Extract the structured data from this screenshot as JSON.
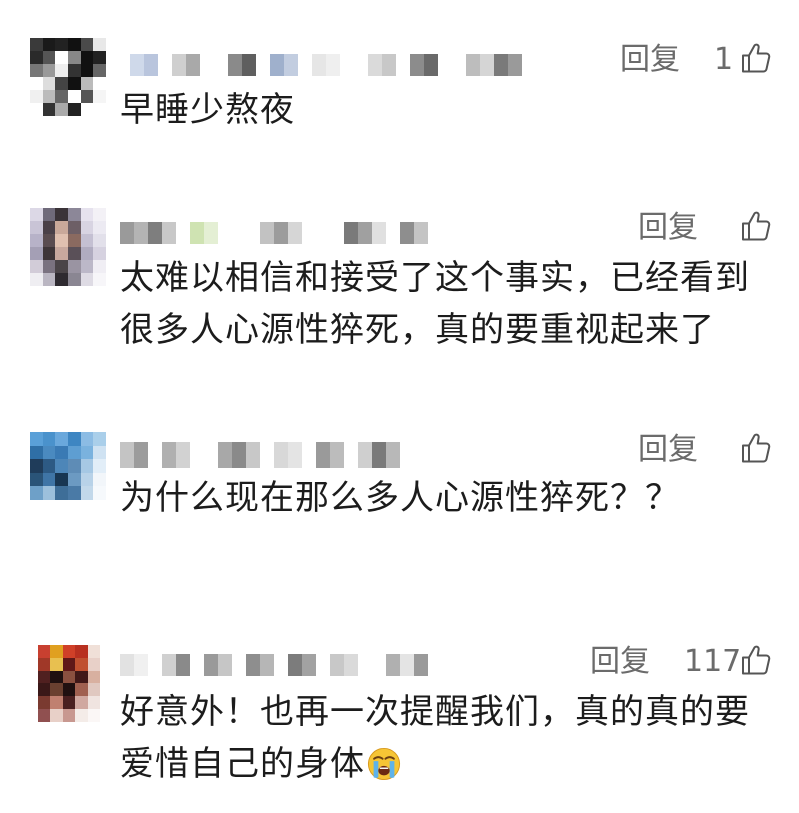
{
  "colors": {
    "text": "#1c1c1c",
    "secondary": "#6b6b6b",
    "background": "#ffffff",
    "icon_stroke": "#555555"
  },
  "comments": [
    {
      "avatar_mosaic": [
        [
          "#3a3a3a",
          "#1a1a1a",
          "#222222",
          "#111111",
          "#4a4a4a",
          "#e8e8e8"
        ],
        [
          "#2a2a2a",
          "#555555",
          "#ffffff",
          "#888888",
          "#111111",
          "#222222"
        ],
        [
          "#777777",
          "#999999",
          "#eeeeee",
          "#333333",
          "#111111",
          "#666666"
        ],
        [
          "#ffffff",
          "#dddddd",
          "#444444",
          "#111111",
          "#bbbbbb",
          "#ffffff"
        ],
        [
          "#f0f0f0",
          "#bbbbbb",
          "#666666",
          "#ffffff",
          "#555555",
          "#f5f5f5"
        ],
        [
          "#ffffff",
          "#333333",
          "#aaaaaa",
          "#222222",
          "#ffffff",
          "#ffffff"
        ]
      ],
      "username_mosaic": [
        "#cfd9ea",
        "#b9c5dd",
        "transparent",
        "#cfcfcf",
        "#a9a9a9",
        "transparent",
        "transparent",
        "#8a8a8a",
        "#5f5f5f",
        "transparent",
        "#9fb0cc",
        "#c2cde0",
        "transparent",
        "#e6e6e6",
        "#efefef",
        "transparent",
        "transparent",
        "#dadada",
        "#c8c8c8",
        "transparent",
        "#8c8c8c",
        "#6a6a6a",
        "transparent",
        "transparent",
        "#bdbdbd",
        "#d5d5d5",
        "#7a7a7a",
        "#9a9a9a"
      ],
      "reply_label": "回复",
      "like_count": "1",
      "like_icon": "thumbs-up-icon",
      "text_lines": [
        "早睡少熬夜"
      ]
    },
    {
      "avatar_mosaic": [
        [
          "#dcd8e6",
          "#6f6a7a",
          "#3a3338",
          "#8c8798",
          "#e6e2ee",
          "#f3f1f6"
        ],
        [
          "#c9c4d6",
          "#4a4048",
          "#c9a89a",
          "#6d5f66",
          "#d8d4e2",
          "#eceaf2"
        ],
        [
          "#b7b2c8",
          "#5a4c50",
          "#e0c0b0",
          "#8a6a60",
          "#c4c0d2",
          "#e2e0ea"
        ],
        [
          "#a49fb5",
          "#3e3538",
          "#c8a89e",
          "#5a5058",
          "#b0acc0",
          "#d6d2e0"
        ],
        [
          "#d2ccd8",
          "#7a7280",
          "#4a4448",
          "#9a94a2",
          "#bcb8c8",
          "#f0eef4"
        ],
        [
          "#efeef2",
          "#bab6c2",
          "#2e2a30",
          "#8a8692",
          "#dedbe4",
          "#f7f6f9"
        ]
      ],
      "username_mosaic": [
        "#9a9a9a",
        "#b4b4b4",
        "#7e7e7e",
        "#c8c8c8",
        "transparent",
        "#cfe3b2",
        "#e4efd4",
        "transparent",
        "transparent",
        "transparent",
        "#c2c2c2",
        "#9c9c9c",
        "#d6d6d6",
        "transparent",
        "transparent",
        "transparent",
        "#7a7a7a",
        "#a0a0a0",
        "#e0e0e0",
        "transparent",
        "#8e8e8e",
        "#c4c4c4"
      ],
      "reply_label": "回复",
      "like_icon": "thumbs-up-icon",
      "text_lines": [
        "太难以相信和接受了这个事实，已经看到",
        "很多人心源性猝死，真的要重视起来了"
      ]
    },
    {
      "avatar_mosaic": [
        [
          "#5aa0d8",
          "#4a92cc",
          "#6aa8dc",
          "#3e86c2",
          "#8cbce4",
          "#aacfea"
        ],
        [
          "#2f6fa6",
          "#4a8ac0",
          "#3a7ab4",
          "#5e9ed2",
          "#7ab2de",
          "#cfe2f2"
        ],
        [
          "#1f3c5a",
          "#2d5a84",
          "#4d86b8",
          "#5e8cb6",
          "#a6c8e4",
          "#e2eef8"
        ],
        [
          "#2a5478",
          "#3f75a6",
          "#183652",
          "#6c9ac2",
          "#b8d2e8",
          "#f2f6fa"
        ],
        [
          "#6ea0c8",
          "#9cc0dc",
          "#3e6e98",
          "#4a7aa6",
          "#c2d8ea",
          "#f6f9fc"
        ]
      ],
      "username_mosaic": [
        "#c4c4c4",
        "#9c9c9c",
        "transparent",
        "#b0b0b0",
        "#d2d2d2",
        "transparent",
        "transparent",
        "#a8a8a8",
        "#8a8a8a",
        "#c8c8c8",
        "transparent",
        "#d8d8d8",
        "#e4e4e4",
        "transparent",
        "#9a9a9a",
        "#bcbcbc",
        "transparent",
        "#cfcfcf",
        "#7a7a7a",
        "#b8b8b8"
      ],
      "reply_label": "回复",
      "like_icon": "thumbs-up-icon",
      "text_lines": [
        "为什么现在那么多人心源性猝死？？"
      ]
    },
    {
      "avatar_mosaic": [
        [
          "#c84030",
          "#e0a020",
          "#d04028",
          "#b83020",
          "#f0e0d8"
        ],
        [
          "#a03828",
          "#e8c050",
          "#601818",
          "#c05030",
          "#e8d0c8"
        ],
        [
          "#502020",
          "#201010",
          "#8a5040",
          "#401818",
          "#d8b0a0"
        ],
        [
          "#3a1818",
          "#6a4030",
          "#201010",
          "#a06050",
          "#e0c8c0"
        ],
        [
          "#7a3a30",
          "#c08070",
          "#4a2020",
          "#d0a8a0",
          "#f0e4e0"
        ],
        [
          "#905050",
          "#e8d0c8",
          "#c89890",
          "#f4ece8",
          "#fbf7f6"
        ]
      ],
      "username_mosaic": [
        "#e2e2e2",
        "#f0f0f0",
        "transparent",
        "#d0d0d0",
        "#8a8a8a",
        "transparent",
        "#9a9a9a",
        "#c6c6c6",
        "transparent",
        "#8e8e8e",
        "#b6b6b6",
        "transparent",
        "#7c7c7c",
        "#a2a2a2",
        "transparent",
        "#c8c8c8",
        "#dadada",
        "transparent",
        "transparent",
        "#b0b0b0",
        "#e4e4e4",
        "#9a9a9a"
      ],
      "reply_label": "回复",
      "like_count": "117",
      "like_icon": "thumbs-up-icon",
      "emoji_icon": "loudly-crying-face-icon",
      "text_lines": [
        "好意外！也再一次提醒我们，真的真的要",
        "爱惜自己的身体"
      ]
    }
  ]
}
